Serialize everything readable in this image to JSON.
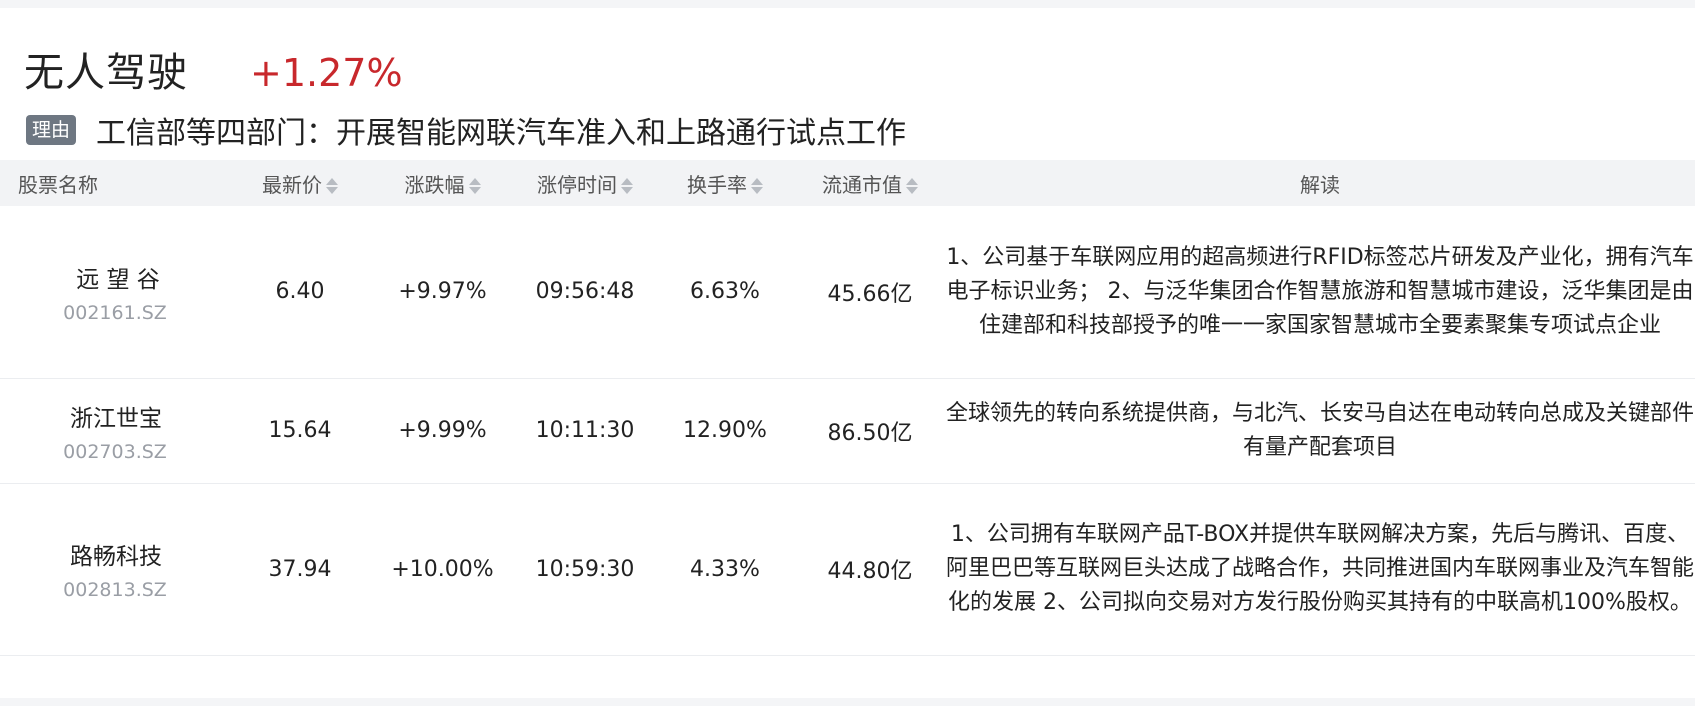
{
  "sector": {
    "name": "无人驾驶",
    "change": "+1.27%"
  },
  "reason": {
    "tag": "理由",
    "text": "工信部等四部门：开展智能网联汽车准入和上路通行试点工作"
  },
  "columns": {
    "name": "股票名称",
    "price": "最新价",
    "change": "涨跌幅",
    "limit_time": "涨停时间",
    "turnover": "换手率",
    "float_cap": "流通市值",
    "interpretation": "解读"
  },
  "rows": [
    {
      "name": "远 望 谷",
      "code": "002161.SZ",
      "price": "6.40",
      "change": "+9.97%",
      "limit_time": "09:56:48",
      "turnover": "6.63%",
      "float_cap": "45.66亿",
      "interpretation": "1、公司基于车联网应用的超高频进行RFID标签芯片研发及产业化，拥有汽车电子标识业务； 2、与泛华集团合作智慧旅游和智慧城市建设，泛华集团是由住建部和科技部授予的唯一一家国家智慧城市全要素聚集专项试点企业"
    },
    {
      "name": "浙江世宝",
      "code": "002703.SZ",
      "price": "15.64",
      "change": "+9.99%",
      "limit_time": "10:11:30",
      "turnover": "12.90%",
      "float_cap": "86.50亿",
      "interpretation": "全球领先的转向系统提供商，与北汽、长安马自达在电动转向总成及关键部件有量产配套项目"
    },
    {
      "name": "路畅科技",
      "code": "002813.SZ",
      "price": "37.94",
      "change": "+10.00%",
      "limit_time": "10:59:30",
      "turnover": "4.33%",
      "float_cap": "44.80亿",
      "interpretation": "1、公司拥有车联网产品T-BOX并提供车联网解决方案，先后与腾讯、百度、阿里巴巴等互联网巨头达成了战略合作，共同推进国内车联网事业及汽车智能化的发展 2、公司拟向交易对方发行股份购买其持有的中联高机100%股权。"
    }
  ],
  "icons": {
    "sort": "sort-icon"
  },
  "colors": {
    "up_red": "#c8282c",
    "tag_bg": "#6e7782",
    "header_bg": "#f2f3f5"
  }
}
